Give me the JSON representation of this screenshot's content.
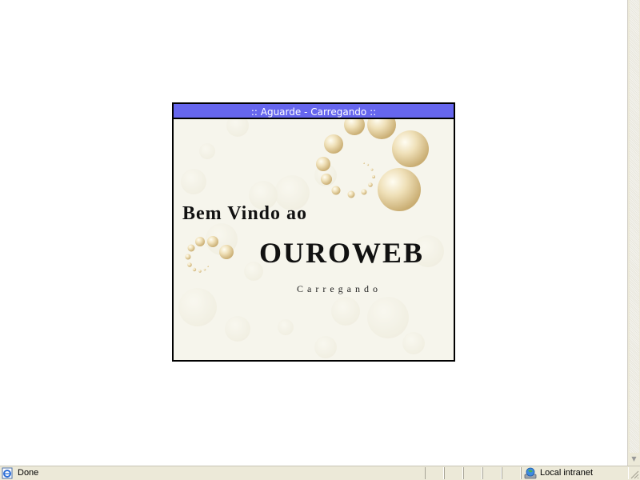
{
  "dialog": {
    "title": ":: Aguarde - Carregando ::",
    "welcome": "Bem Vindo ao",
    "brand": "OUROWEB",
    "loading": "Carregando"
  },
  "statusbar": {
    "status": "Done",
    "zone": "Local intranet",
    "status_icon": "ie-page-icon",
    "zone_icon": "intranet-globe-icon"
  },
  "colors": {
    "title_bar": "#6666ee",
    "dialog_bg": "#f6f5ec",
    "pearl": "#e6d3a3",
    "status_bg": "#ece9d8"
  }
}
